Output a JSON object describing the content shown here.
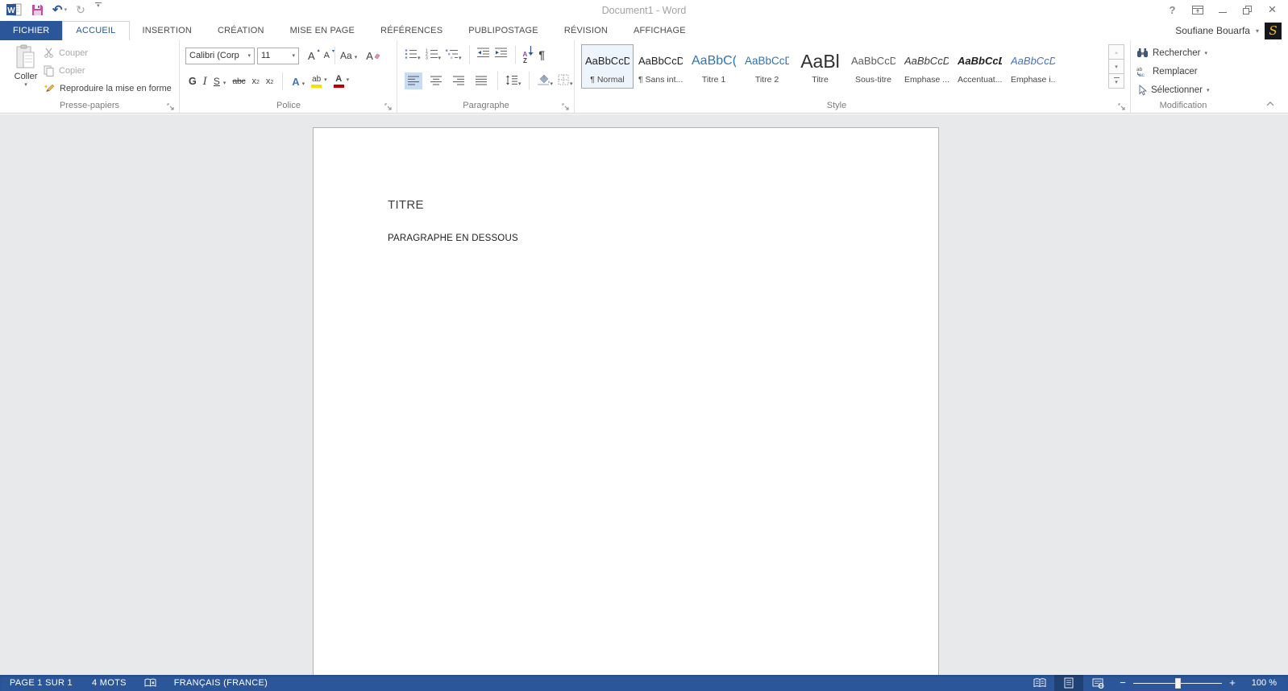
{
  "icons": {
    "caret": "▾",
    "caret_up": "▴",
    "close": "×",
    "undo": "↶",
    "redo": "↻"
  },
  "title_bar": {
    "title": "Document1 - Word",
    "help": "?"
  },
  "account": {
    "name": "Soufiane Bouarfa",
    "avatar_letter": "S"
  },
  "tabs": [
    {
      "label": "FICHIER",
      "file": true
    },
    {
      "label": "ACCUEIL",
      "active": true
    },
    {
      "label": "INSERTION"
    },
    {
      "label": "CRÉATION"
    },
    {
      "label": "MISE EN PAGE"
    },
    {
      "label": "RÉFÉRENCES"
    },
    {
      "label": "PUBLIPOSTAGE"
    },
    {
      "label": "RÉVISION"
    },
    {
      "label": "AFFICHAGE"
    }
  ],
  "ribbon": {
    "clipboard": {
      "group_label": "Presse-papiers",
      "paste": "Coller",
      "cut": "Couper",
      "copy": "Copier",
      "format_painter": "Reproduire la mise en forme"
    },
    "font": {
      "group_label": "Police",
      "name": "Calibri (Corp",
      "size": "11",
      "grow": "A",
      "shrink": "A",
      "change_case": "Aa",
      "clear_format": "A",
      "bold": "G",
      "italic": "I",
      "underline": "S",
      "strikethrough": "abc",
      "sub_base": "x",
      "sub_digit": "2",
      "sup_base": "x",
      "sup_digit": "2",
      "effects_letter": "A",
      "highlight_letters": "ab",
      "color_letter": "A"
    },
    "paragraph": {
      "group_label": "Paragraphe",
      "sort_a": "A",
      "sort_z": "Z",
      "pilcrow": "¶"
    },
    "styles": {
      "group_label": "Style",
      "items": [
        {
          "preview": "AaBbCcDc",
          "label": "¶ Normal",
          "variant": "normal",
          "selected": true
        },
        {
          "preview": "AaBbCcDc",
          "label": "¶ Sans int...",
          "variant": "normal"
        },
        {
          "preview": "AaBbC(",
          "label": "Titre 1",
          "variant": "titre1"
        },
        {
          "preview": "AaBbCcD",
          "label": "Titre 2",
          "variant": "titre2"
        },
        {
          "preview": "AaBl",
          "label": "Titre",
          "variant": "titre"
        },
        {
          "preview": "AaBbCcD",
          "label": "Sous-titre",
          "variant": "soustitre"
        },
        {
          "preview": "AaBbCcDt",
          "label": "Emphase ...",
          "variant": "emphase"
        },
        {
          "preview": "AaBbCcDt",
          "label": "Accentuat...",
          "variant": "accentuation"
        },
        {
          "preview": "AaBbCcDt",
          "label": "Emphase i...",
          "variant": "emphase-intense"
        }
      ]
    },
    "editing": {
      "group_label": "Modification",
      "find": "Rechercher",
      "replace": "Remplacer",
      "select": "Sélectionner"
    }
  },
  "document": {
    "title": "TITRE",
    "body": "PARAGRAPHE EN DESSOUS"
  },
  "status_bar": {
    "page": "PAGE 1 SUR 1",
    "words": "4 MOTS",
    "language": "FRANÇAIS (FRANCE)",
    "zoom_out": "−",
    "zoom_in": "+",
    "zoom_level": "100 %"
  },
  "colors": {
    "accent": "#2b579a",
    "save_icon": "#c04b9e",
    "highlight_yellow": "#f7e000",
    "font_color_red": "#c00000",
    "heading_blue": "#2e74b5"
  }
}
